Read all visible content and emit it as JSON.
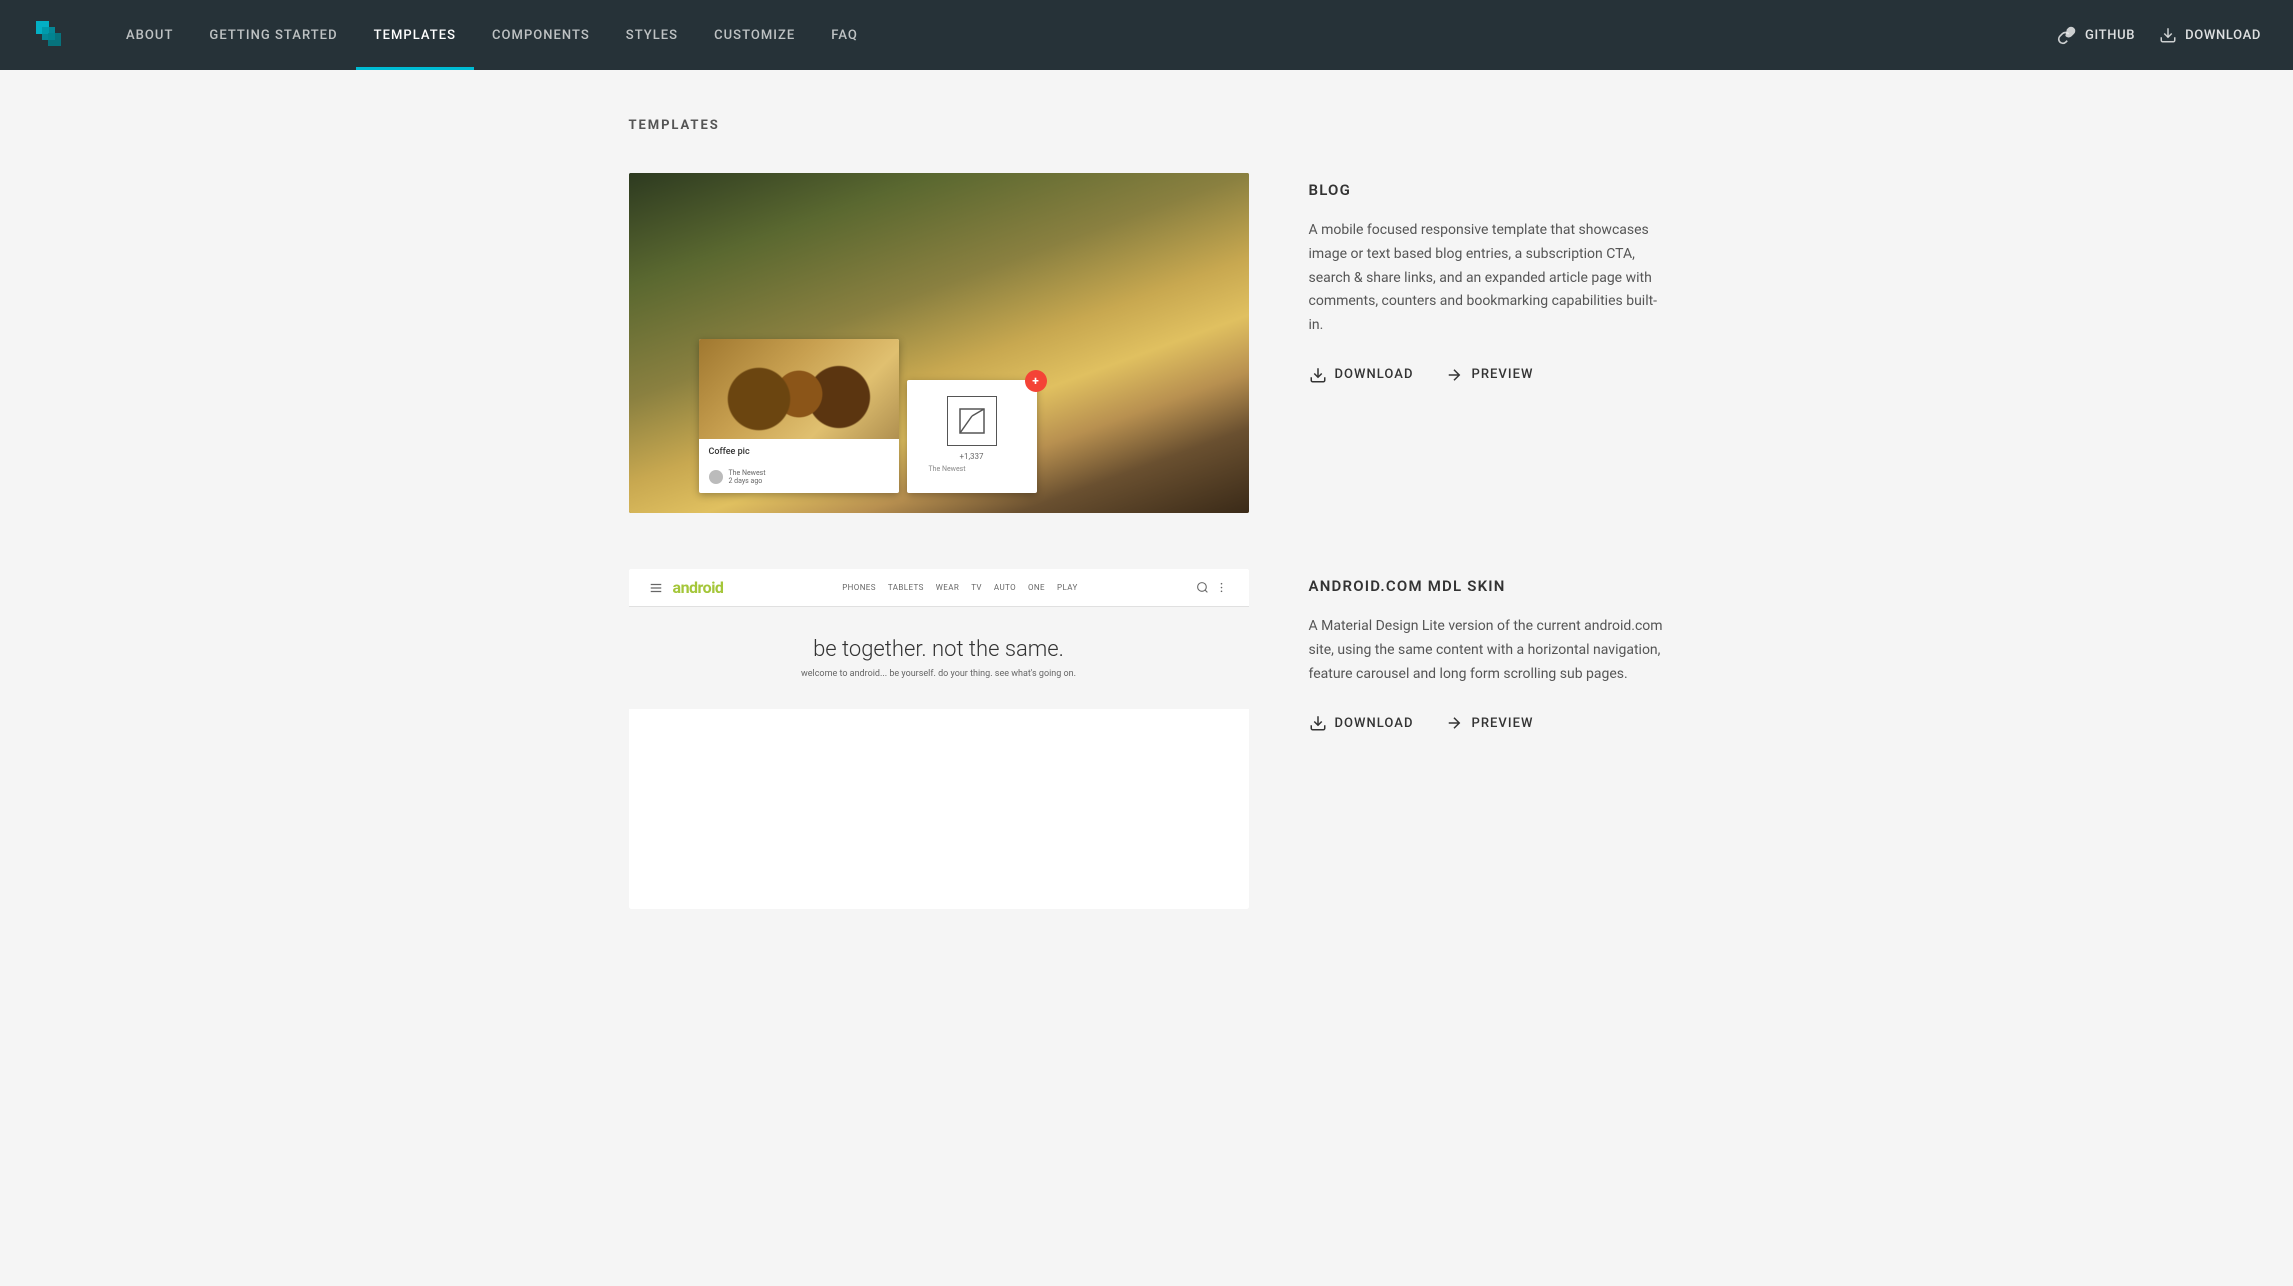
{
  "header": {
    "logo_alt": "MDL Logo",
    "nav_items": [
      {
        "id": "about",
        "label": "ABOUT",
        "active": false
      },
      {
        "id": "getting-started",
        "label": "GETTING STARTED",
        "active": false
      },
      {
        "id": "templates",
        "label": "TEMPLATES",
        "active": true
      },
      {
        "id": "components",
        "label": "COMPONENTS",
        "active": false
      },
      {
        "id": "styles",
        "label": "STYLES",
        "active": false
      },
      {
        "id": "customize",
        "label": "CUSTOMIZE",
        "active": false
      },
      {
        "id": "faq",
        "label": "FAQ",
        "active": false
      }
    ],
    "github_label": "GitHub",
    "download_label": "Download"
  },
  "main": {
    "page_title": "TEMPLATES",
    "templates": [
      {
        "id": "blog",
        "name": "BLOG",
        "description": "A mobile focused responsive template that showcases image or text based blog entries, a subscription CTA, search & share links, and an expanded article page with comments, counters and bookmarking capabilities built-in.",
        "download_label": "Download",
        "preview_label": "Preview",
        "card_caption": "Coffee pic",
        "card_author": "The Newest",
        "card_date": "2 days ago",
        "card_count": "+1,337"
      },
      {
        "id": "android",
        "name": "ANDROID.COM MDL SKIN",
        "description": "A Material Design Lite version of the current android.com site, using the same content with a horizontal navigation, feature carousel and long form scrolling sub pages.",
        "download_label": "Download",
        "preview_label": "Preview",
        "hero_text": "be together. not the same.",
        "hero_sub": "welcome to android... be yourself. do your thing. see what's going on."
      }
    ]
  },
  "colors": {
    "accent": "#00bcd4",
    "header_bg": "#263238",
    "active_nav": "#ffffff",
    "download_icon_color": "#333"
  }
}
